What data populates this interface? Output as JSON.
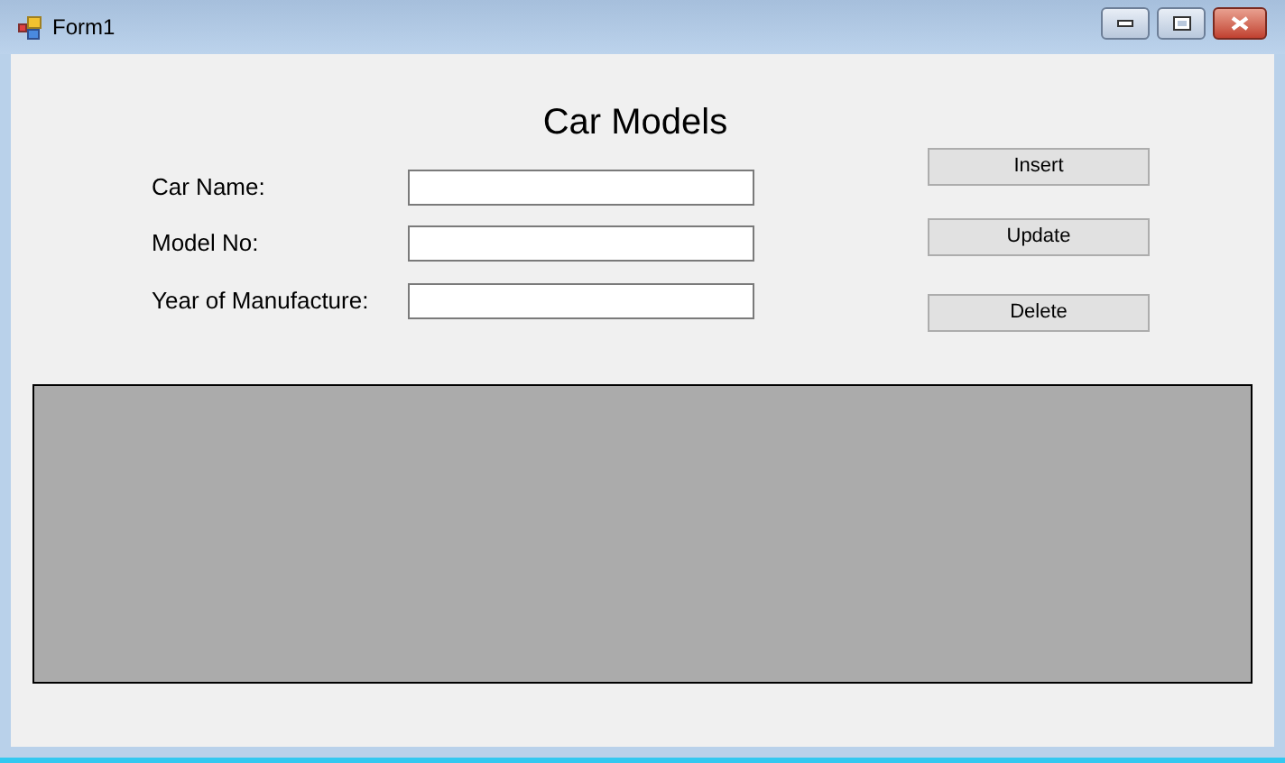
{
  "window": {
    "title": "Form1"
  },
  "heading": "Car Models",
  "fields": [
    {
      "label": "Car Name:"
    },
    {
      "label": "Model No:"
    },
    {
      "label": "Year of Manufacture:"
    }
  ],
  "buttons": [
    "Insert",
    "Update",
    "Delete"
  ]
}
